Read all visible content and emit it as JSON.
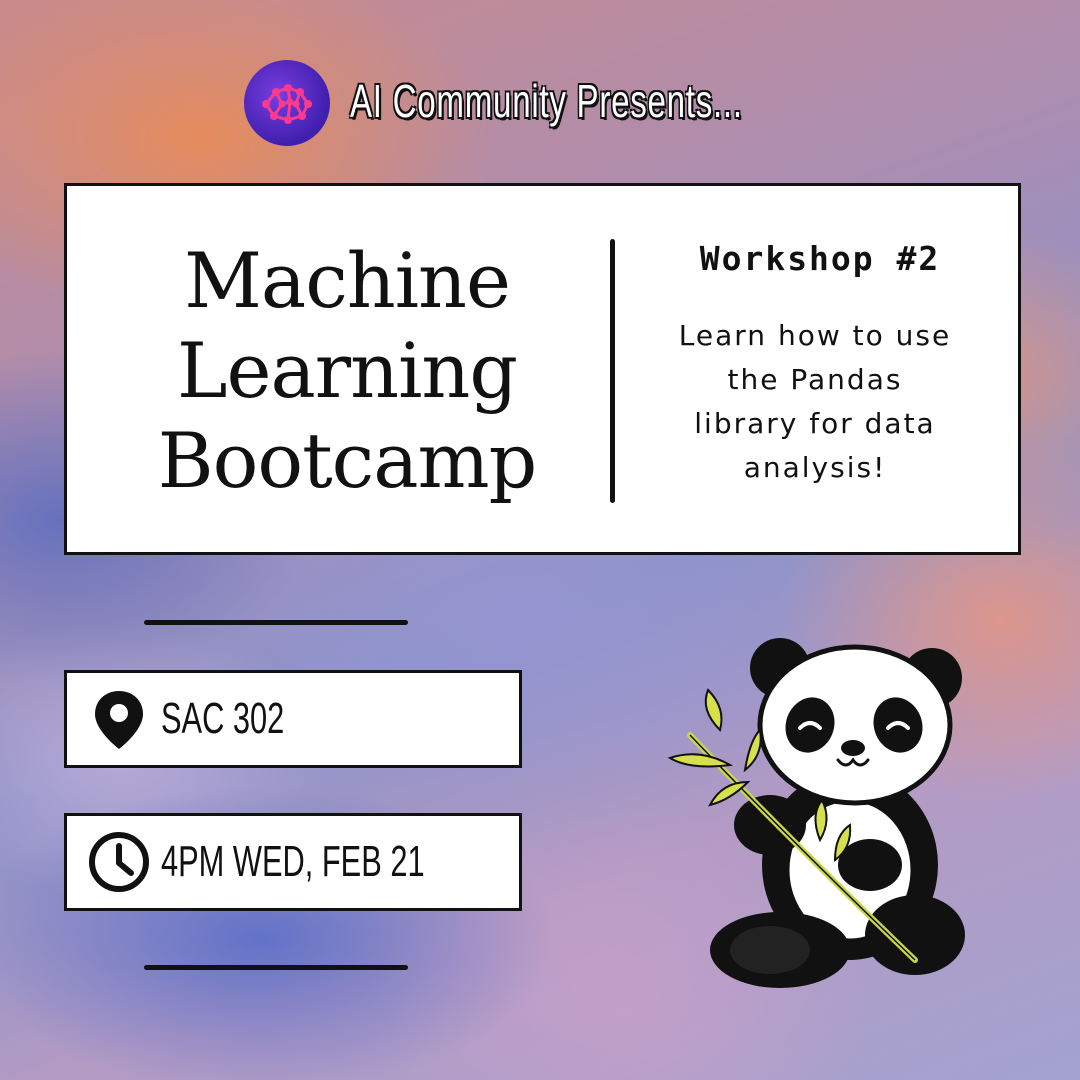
{
  "header": {
    "logo_icon": "brain-network-icon",
    "presents_text": "AI Community Presents..."
  },
  "event": {
    "title_lines": [
      "Machine",
      "Learning",
      "Bootcamp"
    ],
    "workshop": "Workshop #2",
    "description_lines": [
      "Learn how to use",
      "the Pandas",
      "library for data",
      "analysis!"
    ]
  },
  "details": {
    "location": {
      "icon": "map-pin-icon",
      "text": "SAC 302"
    },
    "time": {
      "icon": "clock-icon",
      "text": "4PM WED, FEB 21"
    }
  },
  "illustration": {
    "icon": "panda-with-bamboo-icon"
  },
  "colors": {
    "text": "#111111",
    "box": "#ffffff",
    "logo": "#5a2bd0",
    "accent": "#ff3a8c"
  }
}
